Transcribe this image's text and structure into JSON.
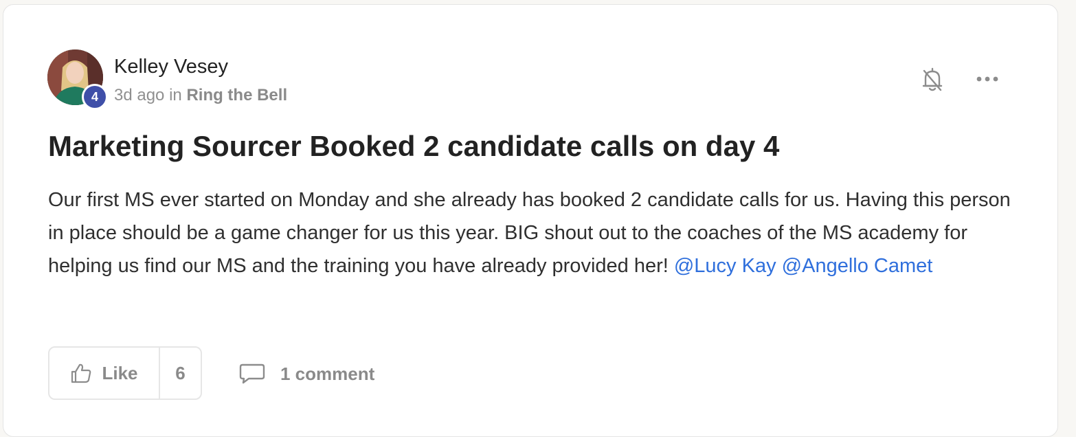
{
  "post": {
    "author": {
      "name": "Kelley Vesey",
      "level": "4"
    },
    "meta": {
      "time": "3d ago",
      "in_word": "in",
      "category": "Ring the Bell"
    },
    "title": "Marketing Sourcer Booked 2 candidate calls on day 4",
    "body_text": "Our first MS ever started on Monday and she already has booked 2 candidate calls for us. Having this person in place should be a game changer for us this year. BIG shout out to the coaches of the MS academy for helping us find our MS and the training you have already provided her!",
    "mentions": [
      "@Lucy Kay",
      "@Angello Camet"
    ]
  },
  "actions": {
    "like_label": "Like",
    "like_count": "6",
    "comment_label": "1 comment"
  },
  "icons": {
    "bell": "bell-off-icon",
    "more": "more-horizontal-icon",
    "like": "thumbs-up-icon",
    "comment": "comment-bubble-icon"
  },
  "colors": {
    "mention": "#2f6fdc",
    "level_badge": "#3f4fa8"
  }
}
